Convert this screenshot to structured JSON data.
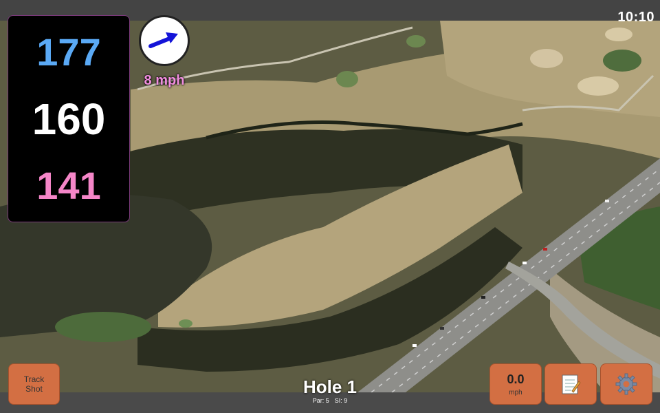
{
  "status": {
    "clock": "10:10"
  },
  "distances": {
    "back": "177",
    "middle": "160",
    "front": "141"
  },
  "wind": {
    "speed_label": "8 mph",
    "direction_icon": "wind-arrow-icon"
  },
  "hole": {
    "title": "Hole 1",
    "par": "Par: 5",
    "stroke_index": "SI: 9"
  },
  "buttons": {
    "track_shot": "Track Shot",
    "speed_value": "0.0",
    "speed_unit": "mph",
    "notes_icon": "notepad-icon",
    "settings_icon": "gear-icon"
  },
  "colors": {
    "back_distance": "#5aa9f5",
    "middle_distance": "#ffffff",
    "front_distance": "#f586c8",
    "button_accent": "#d36f43",
    "wind_label": "#f28ee0"
  }
}
